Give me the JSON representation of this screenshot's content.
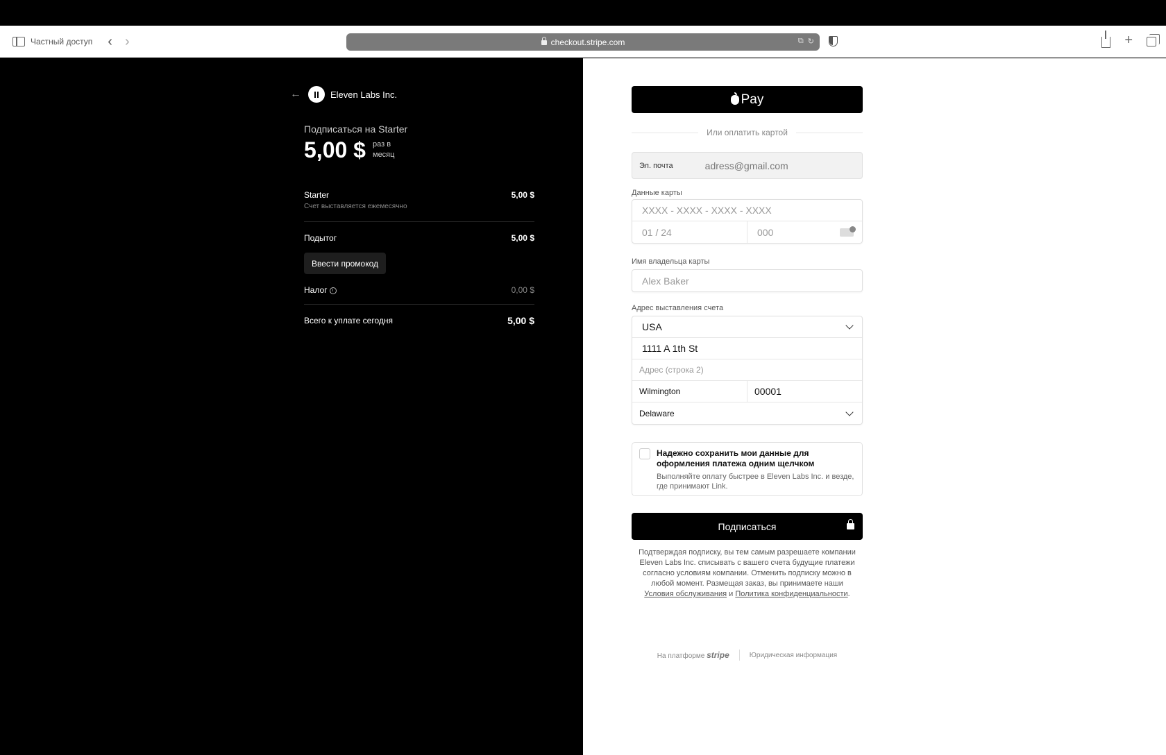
{
  "browser": {
    "private_label": "Частный доступ",
    "url": "checkout.stripe.com"
  },
  "summary": {
    "merchant": "Eleven Labs Inc.",
    "subscribe_title": "Подписаться на Starter",
    "price": "5,00 $",
    "period": "раз в месяц",
    "item_name": "Starter",
    "item_amount": "5,00 $",
    "item_note": "Счет выставляется ежемесячно",
    "subtotal_label": "Подытог",
    "subtotal_amount": "5,00 $",
    "promo_button": "Ввести промокод",
    "tax_label": "Налог",
    "tax_amount": "0,00 $",
    "total_label": "Всего к уплате сегодня",
    "total_amount": "5,00 $"
  },
  "payment": {
    "apple_pay_label": "Pay",
    "or_card": "Или оплатить картой",
    "email_label": "Эл. почта",
    "email_value": "adress@gmail.com",
    "card_label": "Данные карты",
    "card_number_placeholder": "XXXX - XXXX - XXXX - XXXX",
    "expiry_placeholder": "01 / 24",
    "cvc_placeholder": "000",
    "holder_label": "Имя владельца карты",
    "holder_placeholder": "Alex Baker",
    "address_label": "Адрес выставления счета",
    "country": "USA",
    "address_line1": "1111 A 1th St",
    "address_line2_placeholder": "Адрес (строка 2)",
    "city": "Wilmington",
    "zip": "00001",
    "state": "Delaware",
    "save_title": "Надежно сохранить мои данные для оформления платежа одним щелчком",
    "save_desc": "Выполняйте оплату быстрее в Eleven Labs Inc. и везде, где принимают Link.",
    "subscribe_button": "Подписаться",
    "legal_text": "Подтверждая подписку, вы тем самым разрешаете компании Eleven Labs Inc. списывать с вашего счета будущие платежи согласно условиям компании. Отменить подписку можно в любой момент. Размещая заказ, вы принимаете наши",
    "terms_link": "Условия обслуживания",
    "and_word": "и",
    "privacy_link": "Политика конфиденциальности",
    "footer_powered": "На платформе",
    "footer_brand": "stripe",
    "footer_legal": "Юридическая информация"
  }
}
